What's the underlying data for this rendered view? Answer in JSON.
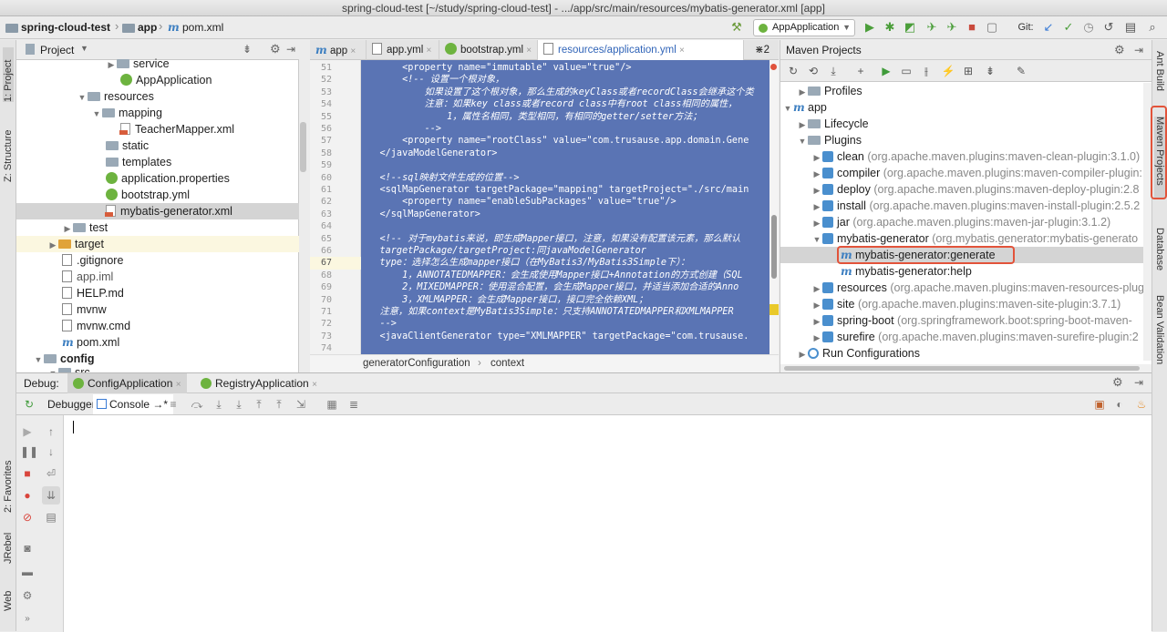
{
  "window": {
    "title": "spring-cloud-test [~/study/spring-cloud-test] - .../app/src/main/resources/mybatis-generator.xml [app]"
  },
  "breadcrumb": {
    "project": "spring-cloud-test",
    "module": "app",
    "file": "pom.xml"
  },
  "toolbar": {
    "run_config": "AppApplication",
    "git_label": "Git:"
  },
  "left_strip": {
    "project": "1: Project",
    "structure": "Z: Structure",
    "favorites": "2: Favorites",
    "jrebel": "JRebel",
    "web": "Web"
  },
  "right_strip": {
    "ant": "Ant Build",
    "maven": "Maven Projects",
    "database": "Database",
    "bean": "Bean Validation"
  },
  "project_panel": {
    "title": "Project",
    "items": [
      {
        "label": "service"
      },
      {
        "label": "AppApplication"
      },
      {
        "label": "resources"
      },
      {
        "label": "mapping"
      },
      {
        "label": "TeacherMapper.xml"
      },
      {
        "label": "static"
      },
      {
        "label": "templates"
      },
      {
        "label": "application.properties"
      },
      {
        "label": "bootstrap.yml"
      },
      {
        "label": "mybatis-generator.xml"
      },
      {
        "label": "test"
      },
      {
        "label": "target"
      },
      {
        "label": ".gitignore"
      },
      {
        "label": "app.iml"
      },
      {
        "label": "HELP.md"
      },
      {
        "label": "mvnw"
      },
      {
        "label": "mvnw.cmd"
      },
      {
        "label": "pom.xml"
      },
      {
        "label": "config"
      },
      {
        "label": "src"
      }
    ]
  },
  "editor": {
    "tabs": [
      {
        "label": "app"
      },
      {
        "label": "app.yml"
      },
      {
        "label": "bootstrap.yml"
      },
      {
        "label": "resources/application.yml"
      }
    ],
    "tab_overflow": "⋇2",
    "line_numbers": [
      "51",
      "52",
      "53",
      "54",
      "55",
      "56",
      "57",
      "58",
      "59",
      "60",
      "61",
      "62",
      "63",
      "64",
      "65",
      "66",
      "67",
      "68",
      "69",
      "70",
      "71",
      "72",
      "73",
      "74"
    ],
    "lines": [
      "        <property name=\"immutable\" value=\"true\"/>",
      "        <!-- 设置一个根对象，",
      "            如果设置了这个根对象，那么生成的keyClass或者recordClass会继承这个类",
      "            注意：如果key class或者record class中有root class相同的属性，",
      "                1，属性名相同，类型相同，有相同的getter/setter方法；",
      "            -->",
      "        <property name=\"rootClass\" value=\"com.trusause.app.domain.Gene",
      "    </javaModelGenerator>",
      "",
      "    <!--sql映射文件生成的位置-->",
      "    <sqlMapGenerator targetPackage=\"mapping\" targetProject=\"./src/main",
      "        <property name=\"enableSubPackages\" value=\"true\"/>",
      "    </sqlMapGenerator>",
      "",
      "    <!-- 对于mybatis来说，即生成Mapper接口，注意，如果没有配置该元素，那么默认",
      "    targetPackage/targetProject:同javaModelGenerator",
      "    type：选择怎么生成mapper接口（在MyBatis3/MyBatis3Simple下）：",
      "        1，ANNOTATEDMAPPER：会生成使用Mapper接口+Annotation的方式创建（SQL",
      "        2，MIXEDMAPPER：使用混合配置，会生成Mapper接口，并适当添加合适的Anno",
      "        3，XMLMAPPER：会生成Mapper接口，接口完全依赖XML；",
      "    注意，如果context是MyBatis3Simple：只支持ANNOTATEDMAPPER和XMLMAPPER",
      "    -->",
      "    <javaClientGenerator type=\"XMLMAPPER\" targetPackage=\"com.trusause.",
      ""
    ],
    "status_path": [
      "generatorConfiguration",
      "context"
    ]
  },
  "maven": {
    "title": "Maven Projects",
    "items": [
      {
        "label": "Profiles",
        "detail": ""
      },
      {
        "label": "app",
        "detail": ""
      },
      {
        "label": "Lifecycle",
        "detail": ""
      },
      {
        "label": "Plugins",
        "detail": ""
      },
      {
        "label": "clean",
        "detail": "(org.apache.maven.plugins:maven-clean-plugin:3.1.0)"
      },
      {
        "label": "compiler",
        "detail": "(org.apache.maven.plugins:maven-compiler-plugin:"
      },
      {
        "label": "deploy",
        "detail": "(org.apache.maven.plugins:maven-deploy-plugin:2.8"
      },
      {
        "label": "install",
        "detail": "(org.apache.maven.plugins:maven-install-plugin:2.5.2"
      },
      {
        "label": "jar",
        "detail": "(org.apache.maven.plugins:maven-jar-plugin:3.1.2)"
      },
      {
        "label": "mybatis-generator",
        "detail": "(org.mybatis.generator:mybatis-generato"
      },
      {
        "label": "mybatis-generator:generate",
        "detail": ""
      },
      {
        "label": "mybatis-generator:help",
        "detail": ""
      },
      {
        "label": "resources",
        "detail": "(org.apache.maven.plugins:maven-resources-plug"
      },
      {
        "label": "site",
        "detail": "(org.apache.maven.plugins:maven-site-plugin:3.7.1)"
      },
      {
        "label": "spring-boot",
        "detail": "(org.springframework.boot:spring-boot-maven-"
      },
      {
        "label": "surefire",
        "detail": "(org.apache.maven.plugins:maven-surefire-plugin:2"
      },
      {
        "label": "Run Configurations",
        "detail": ""
      }
    ]
  },
  "debug": {
    "label": "Debug:",
    "sessions": [
      {
        "label": "ConfigApplication"
      },
      {
        "label": "RegistryApplication"
      }
    ],
    "subtabs": {
      "debugger": "Debugger",
      "console": "Console →*"
    }
  },
  "colors": {
    "selection_bg": "#5a74b4",
    "highlight_box": "#e2533a",
    "accent": "#3064b8"
  }
}
